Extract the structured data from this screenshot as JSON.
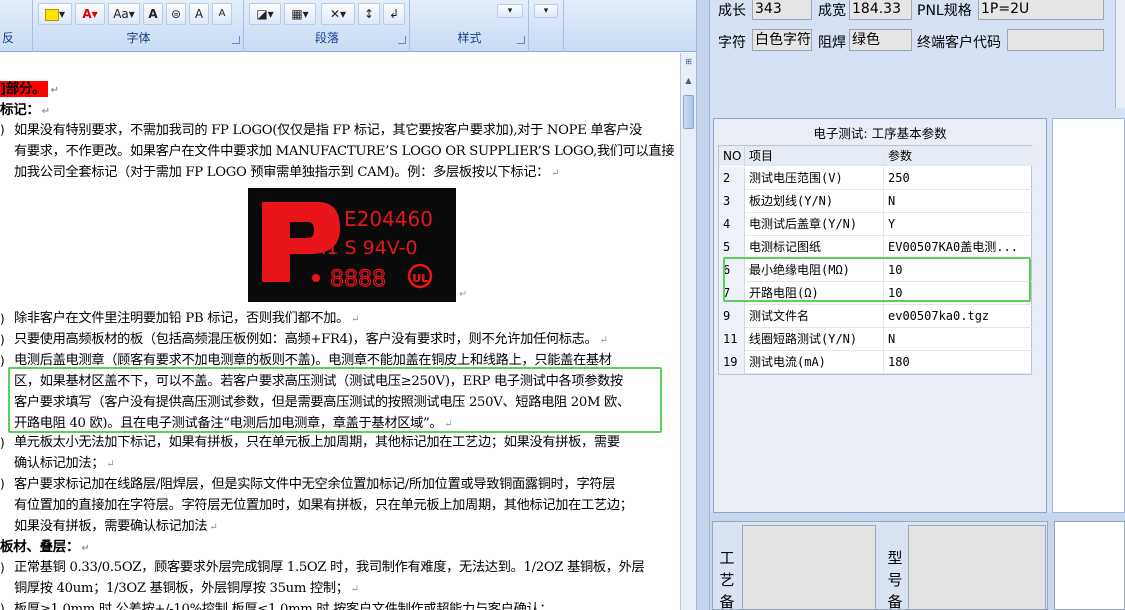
{
  "ribbon": {
    "groups": [
      "字体",
      "段落",
      "样式"
    ],
    "font_buttons": [
      "Aa▾",
      "A",
      "A",
      "A"
    ],
    "edge_label_left": "反"
  },
  "doc": {
    "heading_part": "]部分。",
    "section_mark": "标记：",
    "section_board": "板材、叠层：",
    "para1": [
      "如果没有特别要求，不需加我司的 FP LOGO(仅仅是指 FP 标记，其它要按客户要求加),对于 NOPE 单客户没",
      "有要求，不作更改。如果客户在文件中要求加 MANUFACTURE’S LOGO OR SUPPLIER’S LOGO,我们可以直接",
      "加我公司全套标记（对于需加 FP LOGO 预审需单独指示到 CAM)。例：多层板按以下标记："
    ],
    "logo": {
      "cert": "E204460",
      "grade": "M1 S 94V-0",
      "date": "8888"
    },
    "para2": "除非客户在文件里注明要加铅 PB 标记，否则我们都不加。",
    "para3": "只要使用高频板材的板（包括高频混压板例如：高频+FR4)，客户没有要求时，则不允许加任何标志。",
    "para4": [
      "电测后盖电测章（顾客有要求不加电测章的板则不盖)。电测章不能加盖在铜皮上和线路上，只能盖在基材",
      "区，如果基材区盖不下，可以不盖。若客户要求高压测试（测试电压≥250V)，ERP 电子测试中各项参数按",
      "客户要求填写（客户没有提供高压测试参数，但是需要高压测试的按照测试电压 250V、短路电阻 20M 欧、",
      "开路电阻 40 欧)。且在电子测试备注“电测后加电测章，章盖于基材区域”。"
    ],
    "para5": [
      "单元板太小无法加下标记，如果有拼板，只在单元板上加周期，其他标记加在工艺边；如果没有拼板，需要",
      "确认标记加法；"
    ],
    "para6": [
      "客户要求标记加在线路层/阻焊层，但是实际文件中无空余位置加标记/所加位置或导致铜面露铜时，字符层",
      "有位置加的直接加在字符层。字符层无位置加时，如果有拼板，只在单元板上加周期，其他标记加在工艺边；",
      "如果没有拼板，需要确认标记加法"
    ],
    "para7": [
      "正常基铜 0.33/0.5OZ，顾客要求外层完成铜厚 1.5OZ 时，我司制作有难度，无法达到。1/2OZ 基铜板，外层",
      "铜厚按 40um；1/3OZ 基铜板，外层铜厚按 35um 控制；"
    ],
    "para8": "板厚≥1.0mm 时  公差按+/-10%控制  板厚≤1.0mm 时  按客户文件制作或超能力与客户确认；"
  },
  "form": {
    "fields": [
      {
        "label": "成长",
        "value": "343"
      },
      {
        "label": "成宽",
        "value": "184.33"
      },
      {
        "label": "PNL规格",
        "value": "1P=2U"
      },
      {
        "label": "字符",
        "value": "白色字符"
      },
      {
        "label": "阻焊",
        "value": "绿色"
      },
      {
        "label": "终端客户代码",
        "value": ""
      }
    ],
    "panel_title": "电子测试: 工序基本参数",
    "grid_headers": {
      "no": "NO",
      "item": "项目",
      "value": "参数"
    },
    "grid_rows": [
      {
        "no": "2",
        "item": "测试电压范围(V)",
        "value": "250"
      },
      {
        "no": "3",
        "item": "板边划线(Y/N)",
        "value": "N"
      },
      {
        "no": "4",
        "item": "电测试后盖章(Y/N)",
        "value": "Y"
      },
      {
        "no": "5",
        "item": "电测标记图纸",
        "value": "EV00507KA0盖电测..."
      },
      {
        "no": "6",
        "item": "最小绝缘电阻(MΩ)",
        "value": "10"
      },
      {
        "no": "7",
        "item": "开路电阻(Ω)",
        "value": "10"
      },
      {
        "no": "9",
        "item": "测试文件名",
        "value": "ev00507ka0.tgz"
      },
      {
        "no": "11",
        "item": "线圈短路测试(Y/N)",
        "value": "N"
      },
      {
        "no": "19",
        "item": "测试电流(mA)",
        "value": "180"
      }
    ],
    "bottom_labels": {
      "left": [
        "工",
        "艺",
        "备"
      ],
      "right": [
        "型",
        "号",
        "备"
      ]
    }
  },
  "colors": {
    "highlight": "#5ad05a",
    "red_mark": "#ff0000",
    "logo_red": "#e8151b"
  }
}
